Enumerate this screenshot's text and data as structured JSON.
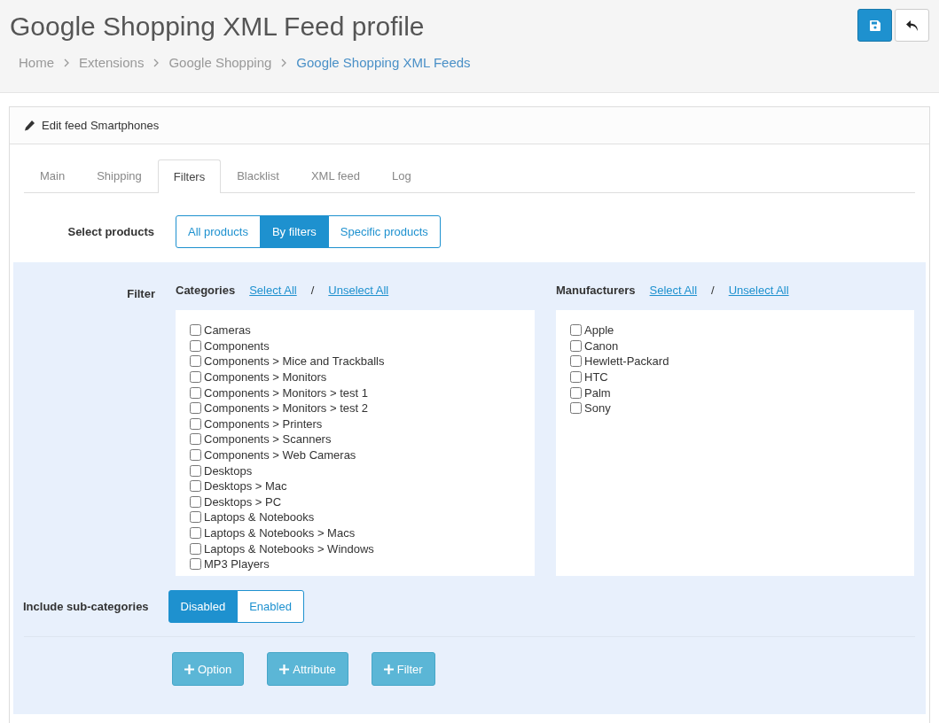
{
  "page": {
    "title": "Google Shopping XML Feed profile",
    "breadcrumb": [
      {
        "label": "Home",
        "current": false
      },
      {
        "label": "Extensions",
        "current": false
      },
      {
        "label": "Google Shopping",
        "current": false
      },
      {
        "label": "Google Shopping XML Feeds",
        "current": true
      }
    ]
  },
  "panel": {
    "heading": "Edit feed Smartphones"
  },
  "tabs": [
    {
      "label": "Main",
      "selected": false
    },
    {
      "label": "Shipping",
      "selected": false
    },
    {
      "label": "Filters",
      "selected": true
    },
    {
      "label": "Blacklist",
      "selected": false
    },
    {
      "label": "XML feed",
      "selected": false
    },
    {
      "label": "Log",
      "selected": false
    }
  ],
  "select_products": {
    "label": "Select products",
    "options": [
      {
        "label": "All products",
        "selected": false
      },
      {
        "label": "By filters",
        "selected": true
      },
      {
        "label": "Specific products",
        "selected": false
      }
    ]
  },
  "filter": {
    "label": "Filter",
    "categories": {
      "title": "Categories",
      "select_all": "Select All",
      "separator": "/",
      "unselect_all": "Unselect All",
      "items": [
        {
          "label": "Cameras",
          "checked": false
        },
        {
          "label": "Components",
          "checked": false
        },
        {
          "label": "Components > Mice and Trackballs",
          "checked": false
        },
        {
          "label": "Components > Monitors",
          "checked": false
        },
        {
          "label": "Components > Monitors > test 1",
          "checked": false
        },
        {
          "label": "Components > Monitors > test 2",
          "checked": false
        },
        {
          "label": "Components > Printers",
          "checked": false
        },
        {
          "label": "Components > Scanners",
          "checked": false
        },
        {
          "label": "Components > Web Cameras",
          "checked": false
        },
        {
          "label": "Desktops",
          "checked": false
        },
        {
          "label": "Desktops > Mac",
          "checked": false
        },
        {
          "label": "Desktops > PC",
          "checked": false
        },
        {
          "label": "Laptops & Notebooks",
          "checked": false
        },
        {
          "label": "Laptops & Notebooks > Macs",
          "checked": false
        },
        {
          "label": "Laptops & Notebooks > Windows",
          "checked": false
        },
        {
          "label": "MP3 Players",
          "checked": false
        }
      ]
    },
    "manufacturers": {
      "title": "Manufacturers",
      "select_all": "Select All",
      "separator": "/",
      "unselect_all": "Unselect All",
      "items": [
        {
          "label": "Apple",
          "checked": false
        },
        {
          "label": "Canon",
          "checked": false
        },
        {
          "label": "Hewlett-Packard",
          "checked": false
        },
        {
          "label": "HTC",
          "checked": false
        },
        {
          "label": "Palm",
          "checked": false
        },
        {
          "label": "Sony",
          "checked": false
        }
      ]
    }
  },
  "include_subcategories": {
    "label": "Include sub-categories",
    "options": [
      {
        "label": "Disabled",
        "selected": true
      },
      {
        "label": "Enabled",
        "selected": false
      }
    ]
  },
  "add_buttons": [
    {
      "label": "Option"
    },
    {
      "label": "Attribute"
    },
    {
      "label": "Filter"
    }
  ]
}
